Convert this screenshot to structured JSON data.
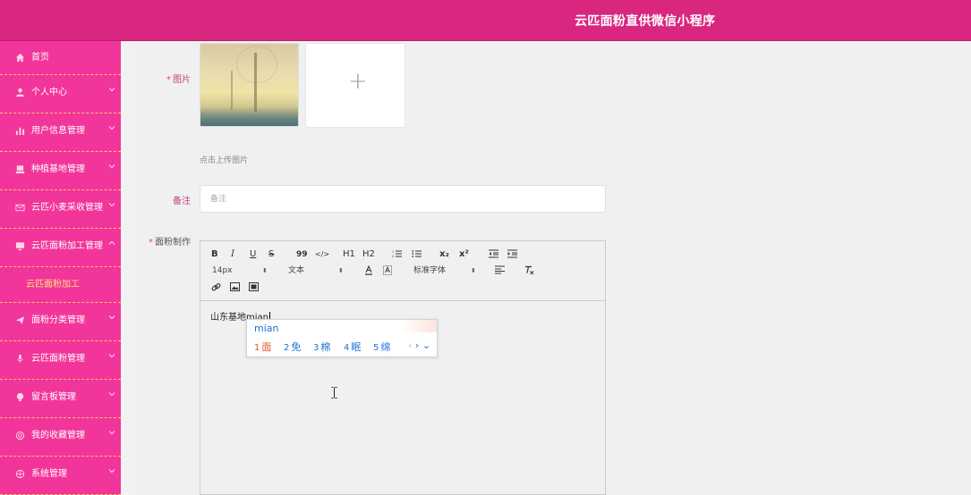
{
  "header": {
    "title": "云匹面粉直供微信小程序"
  },
  "sidebar": {
    "items": [
      {
        "label": "首页",
        "icon": "home-icon"
      },
      {
        "label": "个人中心",
        "icon": "user-icon"
      },
      {
        "label": "用户信息管理",
        "icon": "bar-chart-icon"
      },
      {
        "label": "种植基地管理",
        "icon": "tray-icon"
      },
      {
        "label": "云匹小麦采收管理",
        "icon": "envelope-icon"
      },
      {
        "label": "云匹面粉加工管理",
        "icon": "monitor-icon"
      },
      {
        "label": "面粉分类管理",
        "icon": "send-icon"
      },
      {
        "label": "云匹面粉管理",
        "icon": "microphone-icon"
      },
      {
        "label": "留言板管理",
        "icon": "bulb-icon"
      },
      {
        "label": "我的收藏管理",
        "icon": "globe-icon"
      },
      {
        "label": "系统管理",
        "icon": "compass-icon"
      }
    ],
    "active_sub": "云匹面粉加工"
  },
  "form": {
    "image_label": "图片",
    "upload_hint": "点击上传图片",
    "remark_label": "备注",
    "remark_placeholder": "备注",
    "remark_value": "",
    "production_label": "面粉制作",
    "required_mark": "*"
  },
  "editor": {
    "toolbar": {
      "bold": "B",
      "italic": "I",
      "underline": "U",
      "strike": "S",
      "quote": "99",
      "code": "</>",
      "h1": "H1",
      "h2": "H2",
      "ordered_list": "☰",
      "bullet_list": "☰",
      "subscript": "x₂",
      "superscript": "x²",
      "font_size": "14px",
      "text_style": "文本",
      "font_family": "标准字体"
    },
    "content": "山东基地mian"
  },
  "ime": {
    "pinyin": "mian",
    "candidates": [
      {
        "num": "1",
        "char": "面"
      },
      {
        "num": "2",
        "char": "免"
      },
      {
        "num": "3",
        "char": "棉"
      },
      {
        "num": "4",
        "char": "眠"
      },
      {
        "num": "5",
        "char": "绵"
      }
    ],
    "prev": "‹",
    "next": "›",
    "expand": "⌄"
  },
  "colors": {
    "header": "#d9267f",
    "sidebar": "#f2359a",
    "active_sub": "#ffe27a"
  }
}
